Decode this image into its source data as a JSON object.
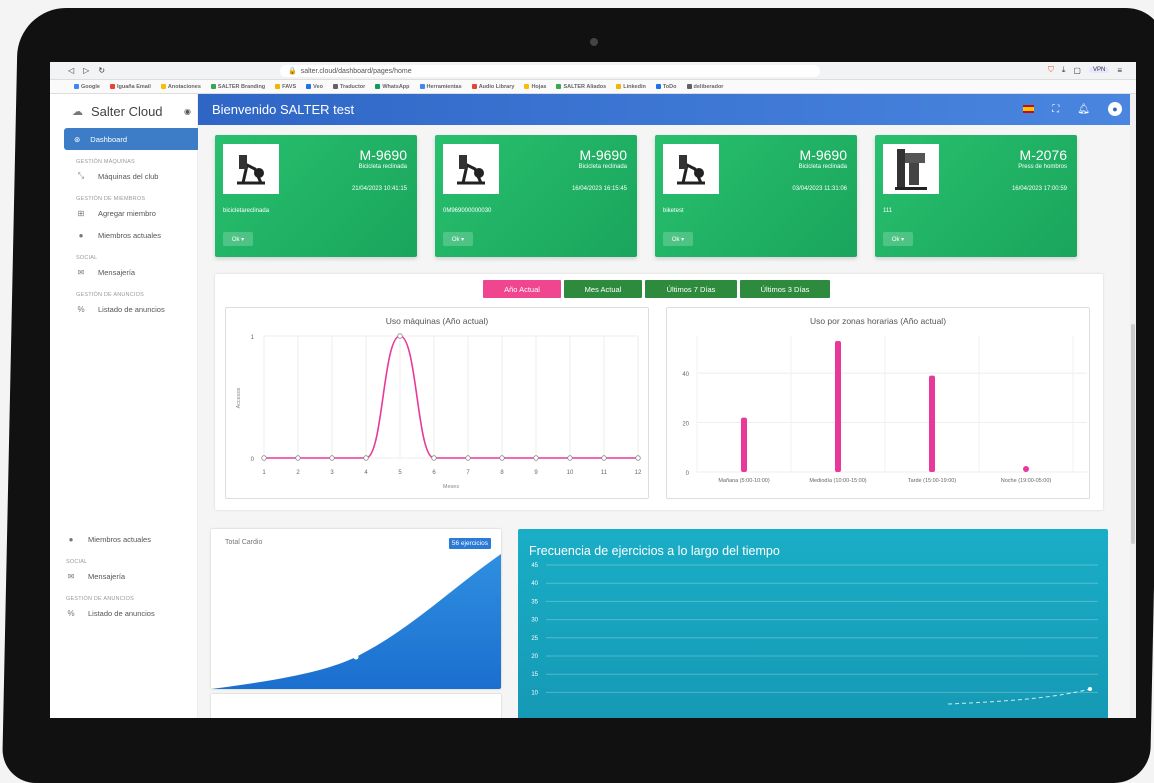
{
  "browser": {
    "url": "salter.cloud/dashboard/pages/home",
    "bookmarks": [
      "Google",
      "Iguaña Email",
      "Anotaciones",
      "SALTER Branding",
      "FAVS",
      "Veo",
      "Traductor",
      "WhatsApp",
      "Herramientas",
      "Audio Library",
      "Hojas",
      "SALTER Aliados",
      "Linkedin",
      "ToDo",
      "deliberador"
    ],
    "vpn_label": "VPN"
  },
  "sidebar": {
    "brand": "Salter Cloud",
    "active_item": "Dashboard",
    "sections": [
      {
        "title": "GESTIÓN MÁQUINAS",
        "items": [
          "Máquinas del club"
        ]
      },
      {
        "title": "GESTIÓN DE MIEMBROS",
        "items": [
          "Agregar miembro",
          "Miembros actuales"
        ]
      },
      {
        "title": "SOCIAL",
        "items": [
          "Mensajería"
        ]
      },
      {
        "title": "GESTIÓN DE ANUNCIOS",
        "items": [
          "Listado de anuncios"
        ]
      }
    ],
    "lower": {
      "members": "Miembros actuales",
      "social": "SOCIAL",
      "messaging": "Mensajería",
      "ads_section": "GESTIÓN DE ANUNCIOS",
      "ads_list": "Listado de anuncios"
    }
  },
  "header": {
    "welcome": "Bienvenido SALTER test"
  },
  "machines": [
    {
      "code": "M-9690",
      "type": "Bicicleta reclinada",
      "date": "21/04/2023 10:41:15",
      "name": "bicicletareclinada",
      "button": "Ok ▾"
    },
    {
      "code": "M-9690",
      "type": "Bicicleta reclinada",
      "date": "16/04/2023 16:15:45",
      "name": "0M969000000030",
      "button": "Ok ▾"
    },
    {
      "code": "M-9690",
      "type": "Bicicleta reclinada",
      "date": "03/04/2023 11:31:06",
      "name": "biketest",
      "button": "Ok ▾"
    },
    {
      "code": "M-2076",
      "type": "Press de hombros",
      "date": "16/04/2023 17:00:59",
      "name": "111",
      "button": "Ok ▾"
    }
  ],
  "period_tabs": [
    "Año Actual",
    "Mes Actual",
    "Últimos 7 Días",
    "Últimos 3 Días"
  ],
  "colors": {
    "active_tab": "#f0458f",
    "inactive_tab": "#2e8b3e",
    "line": "#e8399a",
    "card_green": "#22b463",
    "header_blue": "#3a75d6",
    "freq_teal": "#18a8c2"
  },
  "usage_chart": {
    "title": "Uso máquinas (Año actual)",
    "ylabel": "Accesos",
    "xlabel": "Meses",
    "y_ticks": [
      "0",
      "1"
    ]
  },
  "zones_chart": {
    "title": "Uso por zonas horarias (Año actual)",
    "y_ticks": [
      "0",
      "20",
      "40"
    ]
  },
  "cardio": {
    "label": "Total Cardio",
    "badge": "56 ejercicios"
  },
  "frequency": {
    "title": "Frecuencia de ejercicios a lo largo del tiempo",
    "y_ticks": [
      "45",
      "40",
      "35",
      "30",
      "25",
      "20",
      "15",
      "10"
    ]
  },
  "chart_data": [
    {
      "type": "line",
      "title": "Uso máquinas (Año actual)",
      "xlabel": "Meses",
      "ylabel": "Accesos",
      "x": [
        1,
        2,
        3,
        4,
        5,
        6,
        7,
        8,
        9,
        10,
        11,
        12
      ],
      "values": [
        0,
        0,
        0,
        0,
        1,
        0,
        0,
        0,
        0,
        0,
        0,
        0
      ],
      "ylim": [
        0,
        1
      ],
      "grid": true
    },
    {
      "type": "bar",
      "title": "Uso por zonas horarias (Año actual)",
      "categories": [
        "Mañana (5:00-10:00)",
        "Mediodía (10:00-15:00)",
        "Tarde (15:00-19:00)",
        "Noche (19:00-05:00)"
      ],
      "values": [
        22,
        53,
        39,
        0
      ],
      "ylim": [
        0,
        55
      ],
      "grid": true
    }
  ]
}
